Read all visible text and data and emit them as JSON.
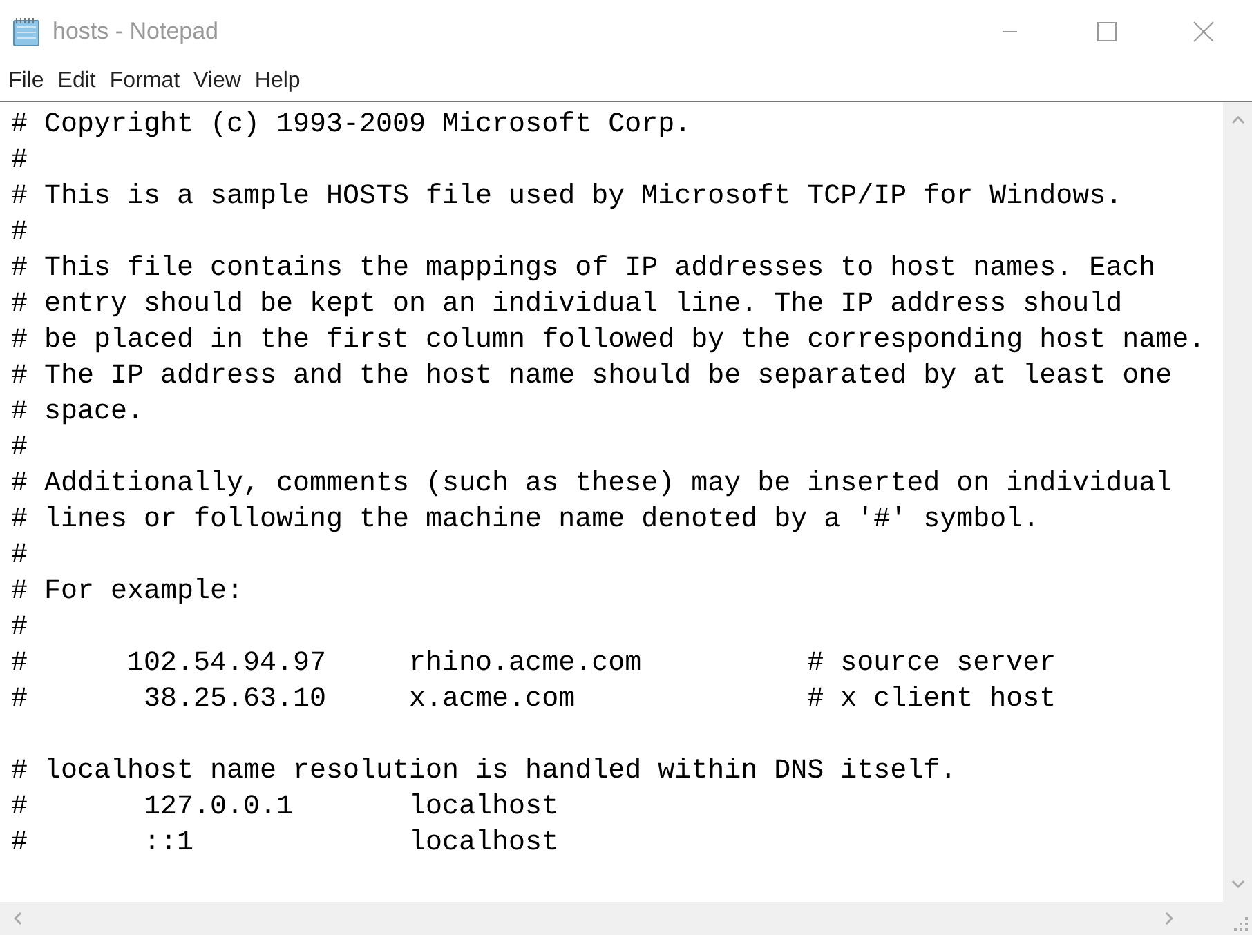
{
  "window": {
    "title": "hosts - Notepad"
  },
  "menu": [
    "File",
    "Edit",
    "Format",
    "View",
    "Help"
  ],
  "blocks": [
    {
      "lines": [
        "# Copyright (c) 1993-2009 Microsoft Corp.",
        "#",
        "# This is a sample HOSTS file used by Microsoft TCP/IP for Windows.",
        "#",
        "# This file contains the mappings of IP addresses to host names. Each",
        "# entry should be kept on an individual line. The IP address should",
        "# be placed in the first column followed by the corresponding host name.",
        "# The IP address and the host name should be separated by at least one",
        "# space.",
        "#",
        "# Additionally, comments (such as these) may be inserted on individual",
        "# lines or following the machine name denoted by a '#' symbol.",
        "#",
        "# For example:",
        "#",
        "#      102.54.94.97     rhino.acme.com          # source server",
        "#       38.25.63.10     x.acme.com              # x client host"
      ]
    },
    {
      "lines": [
        "# localhost name resolution is handled within DNS itself.",
        "#       127.0.0.1       localhost",
        "#       ::1             localhost"
      ]
    }
  ]
}
